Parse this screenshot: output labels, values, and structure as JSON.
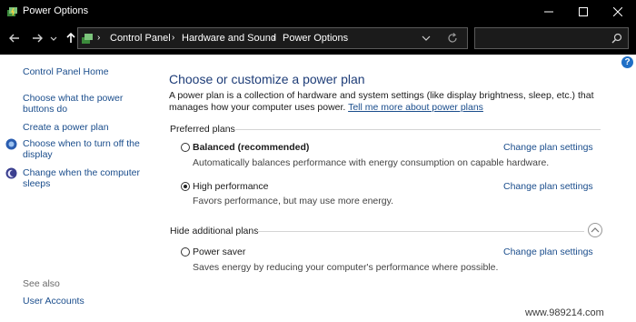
{
  "window": {
    "title": "Power Options"
  },
  "address_bar": {
    "crumbs": [
      "Control Panel",
      "Hardware and Sound",
      "Power Options"
    ],
    "search_placeholder": ""
  },
  "sidebar": {
    "home": "Control Panel Home",
    "links": [
      "Choose what the power buttons do",
      "Create a power plan",
      "Choose when to turn off the display",
      "Change when the computer sleeps"
    ],
    "see_also_label": "See also",
    "see_also_links": [
      "User Accounts"
    ]
  },
  "main": {
    "title": "Choose or customize a power plan",
    "description": "A power plan is a collection of hardware and system settings (like display brightness, sleep, etc.) that manages how your computer uses power.",
    "tell_more": "Tell me more about power plans",
    "preferred_label": "Preferred plans",
    "hide_label": "Hide additional plans",
    "change_label": "Change plan settings",
    "plans": [
      {
        "name": "Balanced (recommended)",
        "desc": "Automatically balances performance with energy consumption on capable hardware.",
        "selected": false
      },
      {
        "name": "High performance",
        "desc": "Favors performance, but may use more energy.",
        "selected": true
      },
      {
        "name": "Power saver",
        "desc": "Saves energy by reducing your computer's performance where possible.",
        "selected": false
      }
    ]
  },
  "watermark": "www.989214.com"
}
